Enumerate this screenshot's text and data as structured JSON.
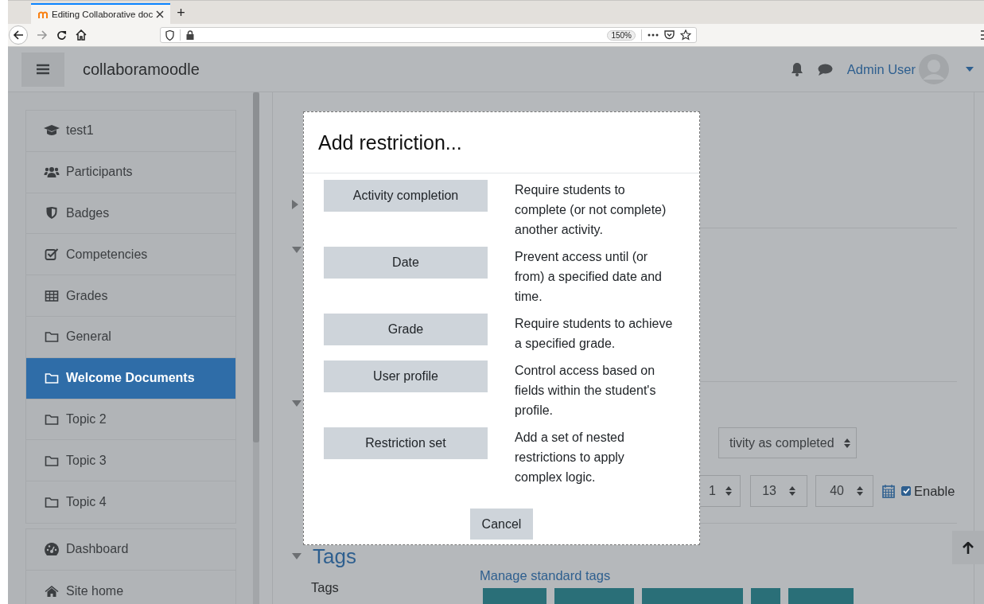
{
  "browser": {
    "tab": {
      "title": "Editing Collaborative doc",
      "selected": true
    },
    "new_tab": "+",
    "zoom": "150%"
  },
  "navbar": {
    "site_name": "collaboramoodle",
    "user_name": "Admin User"
  },
  "sidebar": {
    "groups": [
      [
        {
          "label": "test1",
          "selected": false
        },
        {
          "label": "Participants",
          "selected": false
        },
        {
          "label": "Badges",
          "selected": false
        },
        {
          "label": "Competencies",
          "selected": false
        },
        {
          "label": "Grades",
          "selected": false
        },
        {
          "label": "General",
          "selected": false
        },
        {
          "label": "Welcome Documents",
          "selected": true
        },
        {
          "label": "Topic 2",
          "selected": false
        },
        {
          "label": "Topic 3",
          "selected": false
        },
        {
          "label": "Topic 4",
          "selected": false
        }
      ],
      [
        {
          "label": "Dashboard",
          "selected": false
        },
        {
          "label": "Site home",
          "selected": false
        }
      ]
    ]
  },
  "form": {
    "completion_select": "tivity as completed",
    "time_selects": [
      "1",
      "13",
      "40"
    ],
    "enable": {
      "label": "Enable",
      "checked": true
    },
    "tags_heading": "Tags",
    "tags_label": "Tags",
    "manage_tags_link": "Manage standard tags"
  },
  "modal": {
    "title": "Add restriction...",
    "options": [
      {
        "button": "Activity completion",
        "description": "Require students to complete (or not complete) another activity."
      },
      {
        "button": "Date",
        "description": "Prevent access until (or from) a specified date and time."
      },
      {
        "button": "Grade",
        "description": "Require students to achieve a specified grade."
      },
      {
        "button": "User profile",
        "description": "Control access based on fields within the student's profile."
      },
      {
        "button": "Restriction set",
        "description": "Add a set of nested restrictions to apply complex logic."
      }
    ],
    "cancel": "Cancel"
  }
}
